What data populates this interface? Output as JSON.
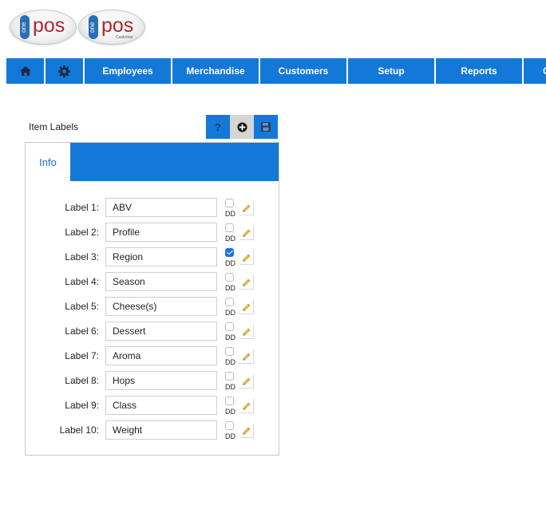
{
  "logos": {
    "primary": {
      "one": "one",
      "pos": "pos"
    },
    "customer": {
      "one": "one",
      "pos": "pos",
      "sub": "Customer"
    }
  },
  "nav": {
    "home_icon": "home-icon",
    "settings_icon": "gear-icon",
    "items": [
      "Employees",
      "Merchandise",
      "Customers",
      "Setup",
      "Reports",
      "C"
    ]
  },
  "panel": {
    "title": "Item Labels",
    "help_label": "?",
    "tabs": [
      "Info"
    ]
  },
  "labels": [
    {
      "label": "Label 1:",
      "value": "ABV",
      "dd": "DD",
      "checked": false
    },
    {
      "label": "Label 2:",
      "value": "Profile",
      "dd": "DD",
      "checked": false
    },
    {
      "label": "Label 3:",
      "value": "Region",
      "dd": "DD",
      "checked": true
    },
    {
      "label": "Label 4:",
      "value": "Season",
      "dd": "DD",
      "checked": false
    },
    {
      "label": "Label 5:",
      "value": "Cheese(s)",
      "dd": "DD",
      "checked": false
    },
    {
      "label": "Label 6:",
      "value": "Dessert",
      "dd": "DD",
      "checked": false
    },
    {
      "label": "Label 7:",
      "value": "Aroma",
      "dd": "DD",
      "checked": false
    },
    {
      "label": "Label 8:",
      "value": "Hops",
      "dd": "DD",
      "checked": false
    },
    {
      "label": "Label 9:",
      "value": "Class",
      "dd": "DD",
      "checked": false
    },
    {
      "label": "Label 10:",
      "value": "Weight",
      "dd": "DD",
      "checked": false
    }
  ],
  "colors": {
    "nav_blue": "#1478d8",
    "logo_red": "#b3242a",
    "logo_blue": "#2a6fb5"
  }
}
